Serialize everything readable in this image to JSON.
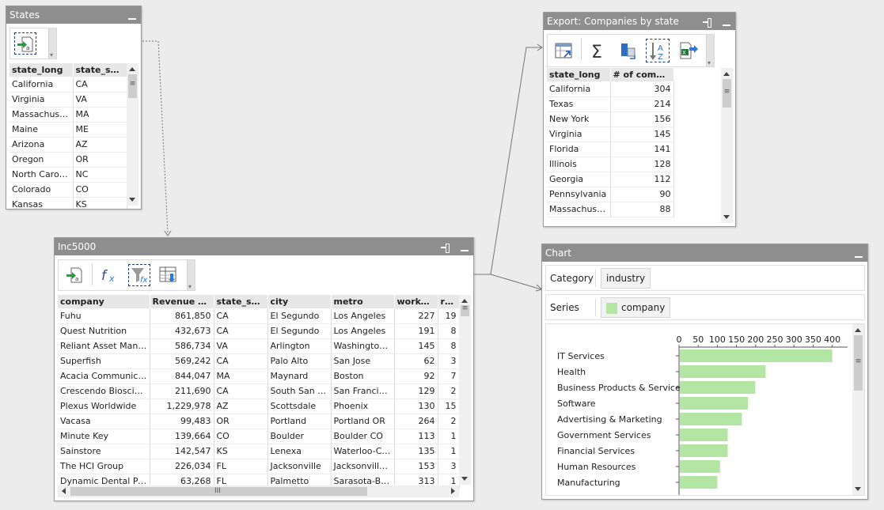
{
  "colors": {
    "titlebar": "#8e8e8e",
    "bar": "#b3e6a3",
    "link": "#666666"
  },
  "states_panel": {
    "title": "States",
    "columns": [
      "state_long",
      "state_short"
    ],
    "rows": [
      [
        "California",
        "CA"
      ],
      [
        "Virginia",
        "VA"
      ],
      [
        "Massachusetts",
        "MA"
      ],
      [
        "Maine",
        "ME"
      ],
      [
        "Arizona",
        "AZ"
      ],
      [
        "Oregon",
        "OR"
      ],
      [
        "North Carolina",
        "NC"
      ],
      [
        "Colorado",
        "CO"
      ],
      [
        "Kansas",
        "KS"
      ]
    ]
  },
  "inc_panel": {
    "title": "Inc5000",
    "columns": [
      "company",
      "Revenue per...",
      "state_short",
      "city",
      "metro",
      "workers",
      "reve"
    ],
    "rows": [
      [
        "Fuhu",
        "861,850",
        "CA",
        "El Segundo",
        "Los Angeles",
        "227",
        "19"
      ],
      [
        "Quest Nutrition",
        "432,673",
        "CA",
        "El Segundo",
        "Los Angeles",
        "191",
        "8"
      ],
      [
        "Reliant Asset Mana...",
        "586,734",
        "VA",
        "Arlington",
        "Washington...",
        "145",
        "8"
      ],
      [
        "Superfish",
        "569,242",
        "CA",
        "Palo Alto",
        "San Jose",
        "62",
        "3"
      ],
      [
        "Acacia Communicati...",
        "844,047",
        "MA",
        "Maynard",
        "Boston",
        "92",
        "7"
      ],
      [
        "Crescendo Bioscience",
        "211,690",
        "CA",
        "South San Fr...",
        "San Francisco",
        "129",
        "2"
      ],
      [
        "Plexus Worldwide",
        "1,229,978",
        "AZ",
        "Scottsdale",
        "Phoenix",
        "130",
        "15"
      ],
      [
        "Vacasa",
        "99,483",
        "OR",
        "Portland",
        "Portland OR",
        "264",
        "2"
      ],
      [
        "Minute Key",
        "139,664",
        "CO",
        "Boulder",
        "Boulder CO",
        "113",
        "1"
      ],
      [
        "Sainstore",
        "142,547",
        "KS",
        "Lenexa",
        "Waterloo-Ce...",
        "135",
        "1"
      ],
      [
        "The HCI Group",
        "226,034",
        "FL",
        "Jacksonville",
        "Jacksonville FL",
        "153",
        "3"
      ],
      [
        "Dynamic Dental Part...",
        "63,268",
        "FL",
        "Palmetto",
        "Sarasota-Bra...",
        "313",
        "1"
      ]
    ],
    "hscroll_grip": "III"
  },
  "export_panel": {
    "title": "Export:  Companies by state",
    "columns": [
      "state_long",
      "# of compan..."
    ],
    "rows": [
      [
        "California",
        "304"
      ],
      [
        "Texas",
        "214"
      ],
      [
        "New York",
        "156"
      ],
      [
        "Virginia",
        "145"
      ],
      [
        "Florida",
        "141"
      ],
      [
        "Illinois",
        "128"
      ],
      [
        "Georgia",
        "112"
      ],
      [
        "Pennsylvania",
        "90"
      ],
      [
        "Massachusetts",
        "88"
      ]
    ]
  },
  "chart_panel": {
    "title": "Chart",
    "category_label": "Category",
    "category_value": "industry",
    "series_label": "Series",
    "series_value": "company"
  },
  "chart_data": {
    "type": "bar",
    "orientation": "horizontal",
    "categories": [
      "IT Services",
      "Health",
      "Business Products & Services",
      "Software",
      "Advertising & Marketing",
      "Government Services",
      "Financial Services",
      "Human Resources",
      "Manufacturing"
    ],
    "series": [
      {
        "name": "company",
        "values": [
          400,
          226,
          199,
          180,
          164,
          127,
          127,
          107,
          100
        ]
      }
    ],
    "xticks": [
      0,
      50,
      100,
      150,
      200,
      250,
      300,
      350,
      400
    ],
    "xlim": [
      0,
      440
    ],
    "xaxis_position": "top",
    "grid": false
  }
}
